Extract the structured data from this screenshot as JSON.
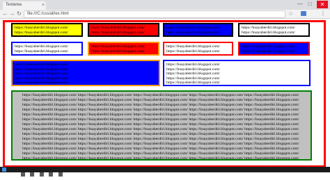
{
  "browser": {
    "tab_title": "Textarea",
    "url": "file:///C:/css/all/ex.html",
    "close_glyph": "×",
    "minimize_glyph": "—",
    "maximize_glyph": "□",
    "window_close_glyph": "✕",
    "icons": {
      "back": "←",
      "forward": "→",
      "reload": "↻",
      "star": "☆",
      "menu": "⋮"
    }
  },
  "textareas": {
    "ta1": "https://buayaberdiri.blogspot.com/\nhttps://buayaberdiri.blogspot.com/\nhttps://buayaberdiri.blogspot.com/",
    "ta2": "https://buayaberdiri.blogspot.com/\nhttps://buayaberdiri.blogspot.com/\nhttps://buayaberdiri.blogspot.com/",
    "ta3": "https://buayaberdiri.blogspot.com/\nhttps://buayaberdiri.blogspot.com/\nhttps://buayaberdiri.blogspot.com/",
    "ta4": "https://buayaberdiri.blogspot.com/\nhttps://buayaberdiri.blogspot.com/\nhttps://buayaberdiri.blogspot.com/",
    "ta5": "https://buayaberdiri.blogspot.com/\nhttps://buayaberdiri.blogspot.com/\nhttps://buayaberdiri.blogspot.com/",
    "ta6": "https://buayaberdiri.blogspot.com/\nhttps://buayaberdiri.blogspot.com/\nhttps://buayaberdiri.blogspot.com/",
    "ta7": "https://buayaberdiri.blogspot.com/\nhttps://buayaberdiri.blogspot.com/\nhttps://buayaberdiri.blogspot.com/",
    "ta8": "https://buayaberdiri.blogspot.com/\nhttps://buayaberdiri.blogspot.com/\nhttps://buayaberdiri.blogspot.com/",
    "ta9": "https://buayaberdiri.blogspot.com/\nhttps://buayaberdiri.blogspot.com/\nhttps://buayaberdiri.blogspot.com/\nhttps://buayaberdiri.blogspot.com/\nhttps://buayaberdiri.blogspot.com/",
    "ta10": "https://buayaberdiri.blogspot.com/\nhttps://buayaberdiri.blogspot.com/\nhttps://buayaberdiri.blogspot.com/\nhttps://buayaberdiri.blogspot.com/\nhttps://buayaberdiri.blogspot.com/",
    "ta11": "https://buayaberdiri.blogspot.com/ https://buayaberdiri.blogspot.com/ https://buayaberdiri.blogspot.com/ https://buayaberdiri.blogspot.com/ https://buayaberdiri.blogspot.com/\nhttps://buayaberdiri.blogspot.com/ https://buayaberdiri.blogspot.com/ https://buayaberdiri.blogspot.com/ https://buayaberdiri.blogspot.com/ https://buayaberdiri.blogspot.com/\nhttps://buayaberdiri.blogspot.com/ https://buayaberdiri.blogspot.com/ https://buayaberdiri.blogspot.com/ https://buayaberdiri.blogspot.com/ https://buayaberdiri.blogspot.com/\nhttps://buayaberdiri.blogspot.com/ https://buayaberdiri.blogspot.com/ https://buayaberdiri.blogspot.com/ https://buayaberdiri.blogspot.com/ https://buayaberdiri.blogspot.com/\nhttps://buayaberdiri.blogspot.com/ https://buayaberdiri.blogspot.com/ https://buayaberdiri.blogspot.com/ https://buayaberdiri.blogspot.com/ https://buayaberdiri.blogspot.com/\nhttps://buayaberdiri.blogspot.com/ https://buayaberdiri.blogspot.com/ https://buayaberdiri.blogspot.com/ https://buayaberdiri.blogspot.com/ https://buayaberdiri.blogspot.com/\nhttps://buayaberdiri.blogspot.com/ https://buayaberdiri.blogspot.com/ https://buayaberdiri.blogspot.com/ https://buayaberdiri.blogspot.com/ https://buayaberdiri.blogspot.com/\nhttps://buayaberdiri.blogspot.com/ https://buayaberdiri.blogspot.com/ https://buayaberdiri.blogspot.com/ https://buayaberdiri.blogspot.com/ https://buayaberdiri.blogspot.com/\nhttps://buayaberdiri.blogspot.com/ https://buayaberdiri.blogspot.com/ https://buayaberdiri.blogspot.com/ https://buayaberdiri.blogspot.com/ https://buayaberdiri.blogspot.com/\nhttps://buayaberdiri.blogspot.com/ https://buayaberdiri.blogspot.com/ https://buayaberdiri.blogspot.com/ https://buayaberdiri.blogspot.com/ https://buayaberdiri.blogspot.com/\nhttps://buayaberdiri.blogspot.com/ https://buayaberdiri.blogspot.com/ https://buayaberdiri.blogspot.com/ https://buayaberdiri.blogspot.com/ https://buayaberdiri.blogspot.com/\nhttps://buayaberdiri.blogspot.com/ https://buayaberdiri.blogspot.com/ https://buayaberdiri.blogspot.com/ https://buayaberdiri.blogspot.com/ https://buayaberdiri.blogspot.com/\nhttps://buayaberdiri.blogspot.com/ https://buayaberdiri.blogspot.com/ https://buayaberdiri.blogspot.com/ https://buayaberdiri.blogspot.com/ https://buayaberdiri.blogspot.com/\nhttps://buayaberdiri.blogspot.com/ https://buayaberdiri.blogspot.com/ https://buayaberdiri.blogspot.com/ https://buayaberdiri.blogspot.com/ https://buayaberdiri.blogspot.com/"
  },
  "colors": {
    "outer_border": "#ff0000",
    "yellow": "#ffff00",
    "red": "#ff0000",
    "blue": "#0000ff",
    "white": "#ffffff",
    "gray": "#c0c0c0",
    "green_border": "#008000",
    "orange_border": "#ff9900"
  }
}
